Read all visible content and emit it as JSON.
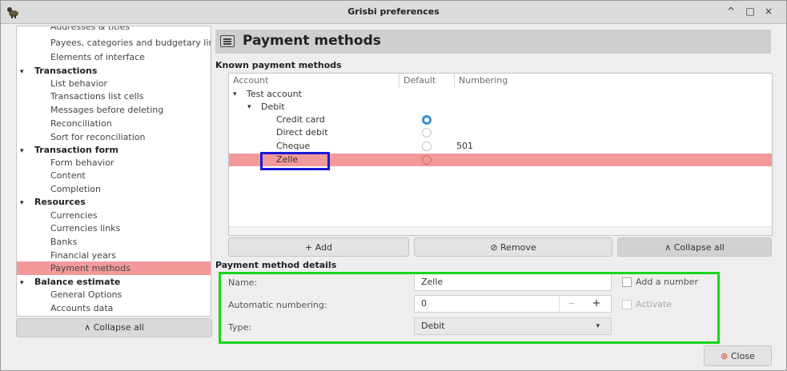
{
  "window": {
    "title": "Grisbi preferences",
    "controls": [
      "^",
      "□",
      "×"
    ]
  },
  "sidebar": {
    "rows": [
      {
        "label": "Addresses & titles",
        "level": 1
      },
      {
        "label": "Payees, categories and budgetary lines",
        "level": 1
      },
      {
        "label": "Elements of interface",
        "level": 1
      },
      {
        "label": "Transactions",
        "level": 0
      },
      {
        "label": "List behavior",
        "level": 1
      },
      {
        "label": "Transactions list cells",
        "level": 1
      },
      {
        "label": "Messages before deleting",
        "level": 1
      },
      {
        "label": "Reconciliation",
        "level": 1
      },
      {
        "label": "Sort for reconciliation",
        "level": 1
      },
      {
        "label": "Transaction form",
        "level": 0
      },
      {
        "label": "Form behavior",
        "level": 1
      },
      {
        "label": "Content",
        "level": 1
      },
      {
        "label": "Completion",
        "level": 1
      },
      {
        "label": "Resources",
        "level": 0
      },
      {
        "label": "Currencies",
        "level": 1
      },
      {
        "label": "Currencies links",
        "level": 1
      },
      {
        "label": "Banks",
        "level": 1
      },
      {
        "label": "Financial years",
        "level": 1
      },
      {
        "label": "Payment methods",
        "level": 1,
        "selected": true
      },
      {
        "label": "Balance estimate",
        "level": 0
      },
      {
        "label": "General Options",
        "level": 1
      },
      {
        "label": "Accounts data",
        "level": 1
      }
    ],
    "collapse_label": "Collapse all"
  },
  "header": {
    "title": "Payment methods"
  },
  "known": {
    "section_label": "Known payment methods",
    "columns": [
      "Account",
      "Default",
      "Numbering"
    ],
    "rows": [
      {
        "label": "Test account",
        "depth": 0,
        "expander": true
      },
      {
        "label": "Debit",
        "depth": 1,
        "expander": true
      },
      {
        "label": "Credit card",
        "depth": 2,
        "default": true,
        "numbering": ""
      },
      {
        "label": "Direct debit",
        "depth": 2,
        "default": false,
        "numbering": ""
      },
      {
        "label": "Cheque",
        "depth": 2,
        "default": false,
        "numbering": "501"
      },
      {
        "label": "Zelle",
        "depth": 2,
        "default": false,
        "numbering": "",
        "selected": true
      }
    ],
    "add_label": "Add",
    "remove_label": "Remove",
    "collapse_label": "Collapse all"
  },
  "details": {
    "section_label": "Payment method details",
    "name_label": "Name:",
    "name_value": "Zelle",
    "add_number_label": "Add a number",
    "auto_label": "Automatic numbering:",
    "auto_value": "0",
    "minus": "−",
    "plus": "+",
    "activate_label": "Activate",
    "type_label": "Type:",
    "type_value": "Debit"
  },
  "footer": {
    "close_label": "Close"
  },
  "colors": {
    "selection": "#f29a9a",
    "radio_on": "#3b8ed8",
    "highlight_blue": "#1a1ad6",
    "highlight_green": "#17d61a",
    "close_icon": "#e0443e"
  }
}
